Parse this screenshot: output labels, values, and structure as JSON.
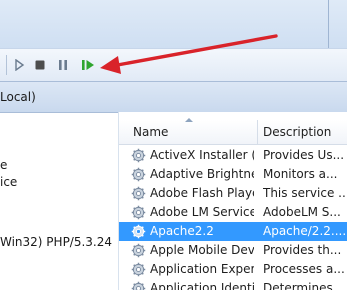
{
  "toolbar": {
    "buttons": [
      {
        "icon": "play-icon",
        "color": "#6b7c8f"
      },
      {
        "icon": "stop-icon",
        "color": "#4d4d4d"
      },
      {
        "icon": "pause-icon",
        "color": "#6b7c8f"
      },
      {
        "icon": "restart-icon",
        "color": "#2fa52f"
      }
    ]
  },
  "scope": {
    "label": "Local)"
  },
  "left_pane": {
    "line1": "e",
    "line2": "ice",
    "line3": "Win32) PHP/5.3.24"
  },
  "services": {
    "columns": {
      "name": "Name",
      "description": "Description"
    },
    "rows": [
      {
        "name": "ActiveX Installer (...",
        "description": "Provides Us..."
      },
      {
        "name": "Adaptive Brightness",
        "description": "Monitors a..."
      },
      {
        "name": "Adobe Flash Playe...",
        "description": "This service ..."
      },
      {
        "name": "Adobe LM Service",
        "description": "AdobeLM S..."
      },
      {
        "name": "Apache2.2",
        "description": "Apache/2.2...."
      },
      {
        "name": "Apple Mobile Devi...",
        "description": "Provides th..."
      },
      {
        "name": "Application Experi...",
        "description": "Processes a..."
      },
      {
        "name": "Application Identity",
        "description": "Determines ..."
      }
    ],
    "selected_index": 4
  },
  "annotation": {
    "arrow_color": "#d9232a"
  }
}
